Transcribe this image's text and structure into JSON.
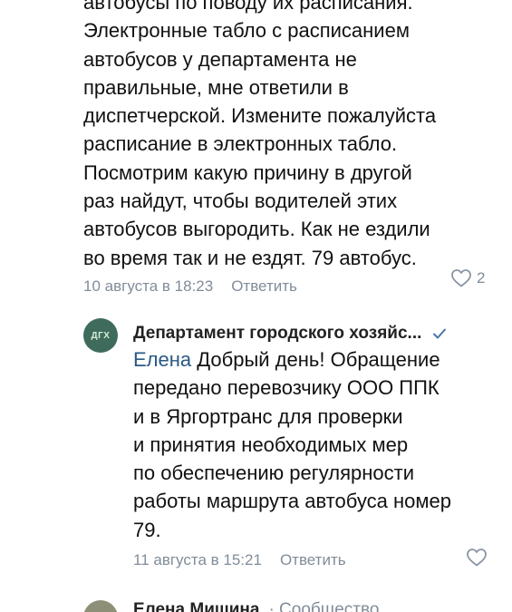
{
  "comment_1": {
    "text": "автобусы по поводу их расписания.\nЭлектронные табло с расписанием\nавтобусов у департамента не\nправильные, мне ответили в\nдиспетчерской. Измените пожалуйста\nрасписание в электронных табло.\nПосмотрим какую причину в другой\nраз найдут, чтобы водителей этих\nавтобусов выгородить. Как не ездили\nво время так и не ездят. 79 автобус.",
    "date": "10 августа в 18:23",
    "reply_label": "Ответить",
    "likes": "2",
    "like_icon": "heart-outline-icon"
  },
  "comment_2": {
    "avatar_text": "ДГХ",
    "author": "Департамент городского хозяйс...",
    "verified_icon": "checkmark-icon",
    "mention": "Елена",
    "text": "Добрый день! Обращение\nпередано перевозчику ООО ППК\nи в Яргортранс для проверки\nи принятия необходимых мер\nпо обеспечению регулярности\nработы маршрута автобуса номер\n79.",
    "date": "11 августа в 15:21",
    "reply_label": "Ответить",
    "like_icon": "heart-outline-icon"
  },
  "comment_3": {
    "author": "Елена Мишина",
    "role": "· Сообщество"
  },
  "colors": {
    "secondary_text": "#818c99",
    "link": "#2a5885",
    "avatar_bg": "#3f6b5c",
    "verified": "#4a76a8"
  }
}
